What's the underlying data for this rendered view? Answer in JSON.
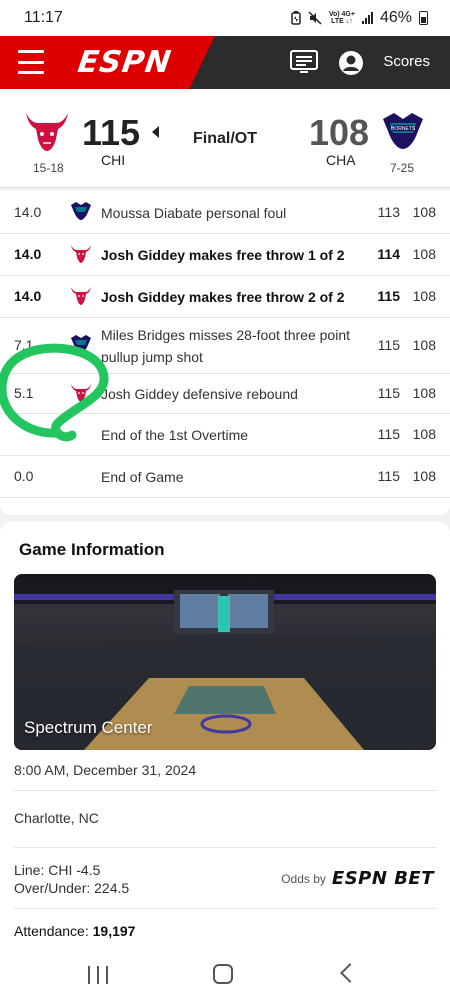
{
  "status_bar": {
    "time": "11:17",
    "network_top": "Vo) 4G+",
    "network_bottom": "LTE ↓↑",
    "battery": "46%"
  },
  "header": {
    "logo_text": "ESPN",
    "scores_label": "Scores"
  },
  "scoreboard": {
    "home": {
      "score": "115",
      "abbr": "CHI",
      "record": "15-18",
      "color": "#ce1141"
    },
    "away": {
      "score": "108",
      "abbr": "CHA",
      "record": "7-25",
      "color": "#1d1160"
    },
    "status": "Final/OT",
    "winner_indicator": "left-arrow"
  },
  "plays": [
    {
      "time": "14.0",
      "team": "CHA",
      "description": "Moussa Diabate personal foul",
      "home_score": "113",
      "away_score": "108",
      "bold": false
    },
    {
      "time": "14.0",
      "team": "CHI",
      "description": "Josh Giddey makes free throw 1 of 2",
      "home_score": "114",
      "away_score": "108",
      "bold": true
    },
    {
      "time": "14.0",
      "team": "CHI",
      "description": "Josh Giddey makes free throw 2 of 2",
      "home_score": "115",
      "away_score": "108",
      "bold": true
    },
    {
      "time": "7.1",
      "team": "CHA",
      "description": "Miles Bridges misses 28-foot three point pullup jump shot",
      "home_score": "115",
      "away_score": "108",
      "bold": false
    },
    {
      "time": "5.1",
      "team": "CHI",
      "description": "Josh Giddey defensive rebound",
      "home_score": "115",
      "away_score": "108",
      "bold": false
    },
    {
      "time": "",
      "team": "",
      "description": "End of the 1st Overtime",
      "home_score": "115",
      "away_score": "108",
      "bold": false
    },
    {
      "time": "0.0",
      "team": "",
      "description": "End of Game",
      "home_score": "115",
      "away_score": "108",
      "bold": false
    }
  ],
  "game_info": {
    "title": "Game Information",
    "venue": "Spectrum Center",
    "datetime": "8:00 AM, December 31, 2024",
    "location": "Charlotte, NC",
    "line": "Line: CHI -4.5",
    "over_under": "Over/Under: 224.5",
    "odds_by": "Odds by",
    "odds_brand": "ESPN BET",
    "attendance_label": "Attendance: ",
    "attendance": "19,197"
  },
  "annotation": {
    "color": "#22c55e"
  }
}
